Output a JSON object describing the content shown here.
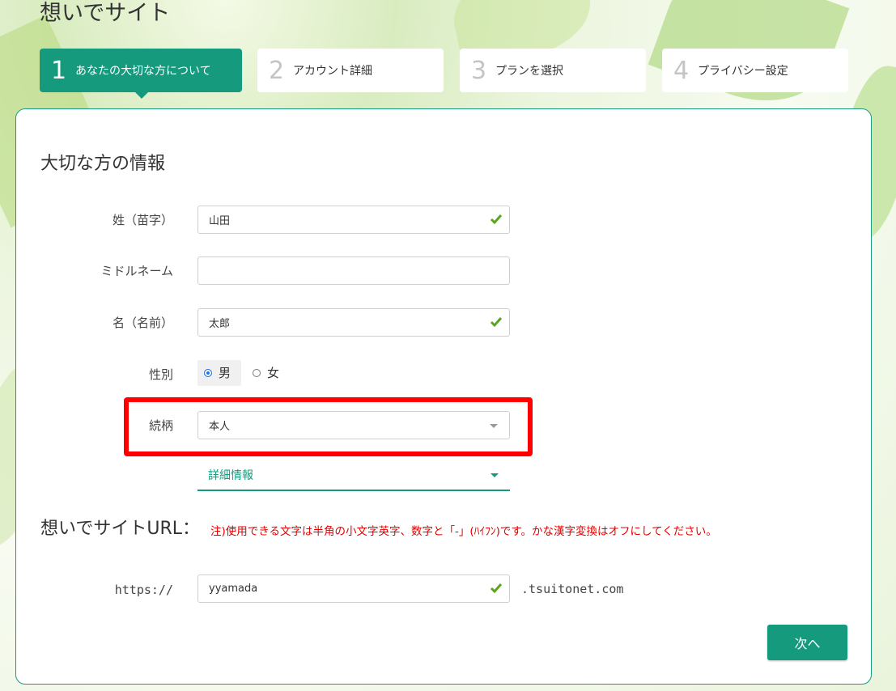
{
  "page_title": "想いでサイト",
  "steps": [
    {
      "num": "1",
      "label": "あなたの大切な方について",
      "active": true
    },
    {
      "num": "2",
      "label": "アカウント詳細",
      "active": false
    },
    {
      "num": "3",
      "label": "プランを選択",
      "active": false
    },
    {
      "num": "4",
      "label": "プライバシー設定",
      "active": false
    }
  ],
  "form": {
    "section_title": "大切な方の情報",
    "last_name": {
      "label": "姓（苗字）",
      "value": "山田",
      "valid": true
    },
    "middle_name": {
      "label": "ミドルネーム",
      "value": ""
    },
    "first_name": {
      "label": "名（名前）",
      "value": "太郎",
      "valid": true
    },
    "gender": {
      "label": "性別",
      "options": [
        "男",
        "女"
      ],
      "selected": "男"
    },
    "relationship": {
      "label": "続柄",
      "value": "本人"
    },
    "details_toggle": "詳細情報"
  },
  "url_section": {
    "title": "想いでサイトURL：",
    "note": "注)使用できる文字は半角の小文字英字、数字と「-」(ﾊｲﾌﾝ)です。かな漢字変換はオフにしてください。",
    "prefix": "https://",
    "value": "yyamada",
    "suffix": ".tsuitonet.com",
    "valid": true
  },
  "next_button": "次へ",
  "colors": {
    "accent": "#159a7e",
    "highlight": "#ff0000",
    "note": "#e60000",
    "check": "#5aa51e"
  }
}
